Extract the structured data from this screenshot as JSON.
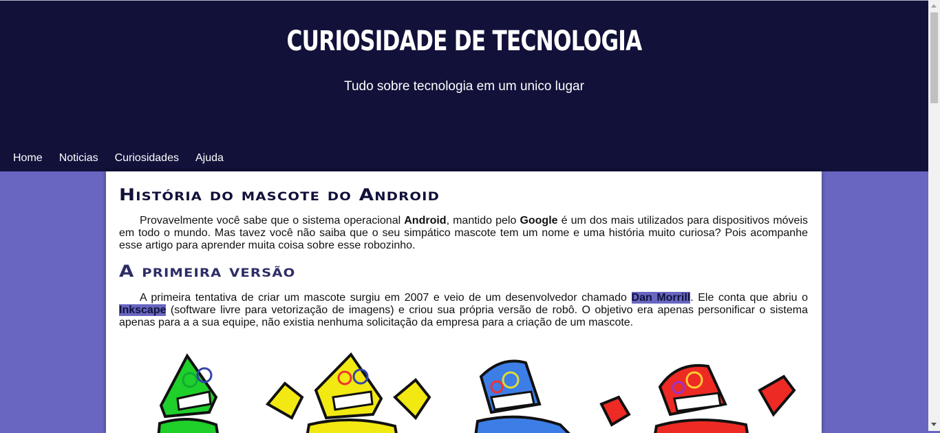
{
  "header": {
    "title": "Curiosidade de Tecnologia",
    "subtitle": "Tudo sobre tecnologia em um unico lugar"
  },
  "nav": [
    "Home",
    "Noticias",
    "Curiosidades",
    "Ajuda"
  ],
  "article": {
    "heading": "História do mascote do Android",
    "intro": {
      "pre": "Provavelmente você sabe que o sistema operacional ",
      "b1": "Android",
      "mid": ", mantido pelo ",
      "b2": "Google",
      "post": " é um dos mais utilizados para dispositivos móveis em todo o mundo. Mas tavez você não saiba que o seu simpático mascote tem um nome e uma história muito curiosa? Pois acompanhe esse artigo para aprender muita coisa sobre esse robozinho."
    },
    "section_heading": "A primeira versão",
    "section": {
      "pre": "A primeira tentativa de criar um mascote surgiu em 2007 e veio de um desenvolvedor chamado ",
      "hl1": "Dan Morrill",
      "mid": ". Ele conta que abriu o ",
      "hl2": "Inkscape",
      "post": " (software livre para vetorização de imagens) e criou sua própria versão de robô. O objetivo era apenas personificar o sistema apenas para a a sua equipe, não existia nenhuma solicitação da empresa para a criação de um mascote."
    }
  },
  "robots": [
    {
      "color": "#1fcf2a",
      "name": "green-robot"
    },
    {
      "color": "#f2e812",
      "name": "yellow-robot"
    },
    {
      "color": "#3d7de6",
      "name": "blue-robot"
    },
    {
      "color": "#ee2a24",
      "name": "red-robot"
    }
  ],
  "colors": {
    "header_bg": "#11113a",
    "page_bg": "#6866c1",
    "highlight": "#6866c1"
  }
}
